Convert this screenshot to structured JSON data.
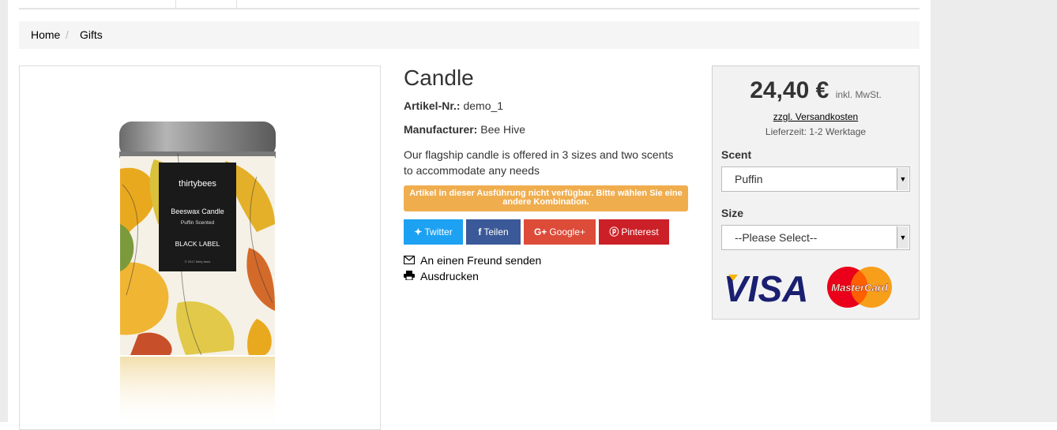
{
  "breadcrumb": {
    "home": "Home",
    "separator": "/",
    "current": "Gifts"
  },
  "product": {
    "title": "Candle",
    "reference_label": "Artikel-Nr.:",
    "reference_value": "demo_1",
    "manufacturer_label": "Manufacturer:",
    "manufacturer_value": "Bee Hive",
    "description": "Our flagship candle is offered in 3 sizes and two scents to accommodate any needs",
    "availability_alert": "Artikel in dieser Ausführung nicht verfügbar. Bitte wählen Sie eine andere Kombination."
  },
  "image": {
    "brand": "thirtybees",
    "line1": "Beeswax Candle",
    "line2": "Puffin Scented",
    "line3": "BLACK LABEL",
    "line4": "© 2017 thirty bees"
  },
  "share": {
    "twitter": {
      "label": "Twitter",
      "icon": "twitter-icon",
      "color": "#1da1f2"
    },
    "facebook": {
      "label": "Teilen",
      "icon": "facebook-icon",
      "color": "#3b5998"
    },
    "google": {
      "label": "Google+",
      "icon": "google-plus-icon",
      "color": "#dd4b39"
    },
    "pinterest": {
      "label": "Pinterest",
      "icon": "pinterest-icon",
      "color": "#cb2027"
    }
  },
  "actions": {
    "send_friend": "An einen Freund senden",
    "print": "Ausdrucken"
  },
  "buy": {
    "price": "24,40 €",
    "tax_note": "inkl. MwSt.",
    "shipping_link": "zzgl. Versandkosten",
    "delivery": "Lieferzeit: 1-2 Werktage",
    "scent_label": "Scent",
    "scent_value": "Puffin",
    "size_label": "Size",
    "size_value": "--Please Select--",
    "cards": {
      "visa": "VISA",
      "mastercard": "MasterCard"
    }
  },
  "colors": {
    "alert": "#f0ad4e",
    "visa_blue": "#1a1f71",
    "visa_gold": "#f7b600"
  }
}
